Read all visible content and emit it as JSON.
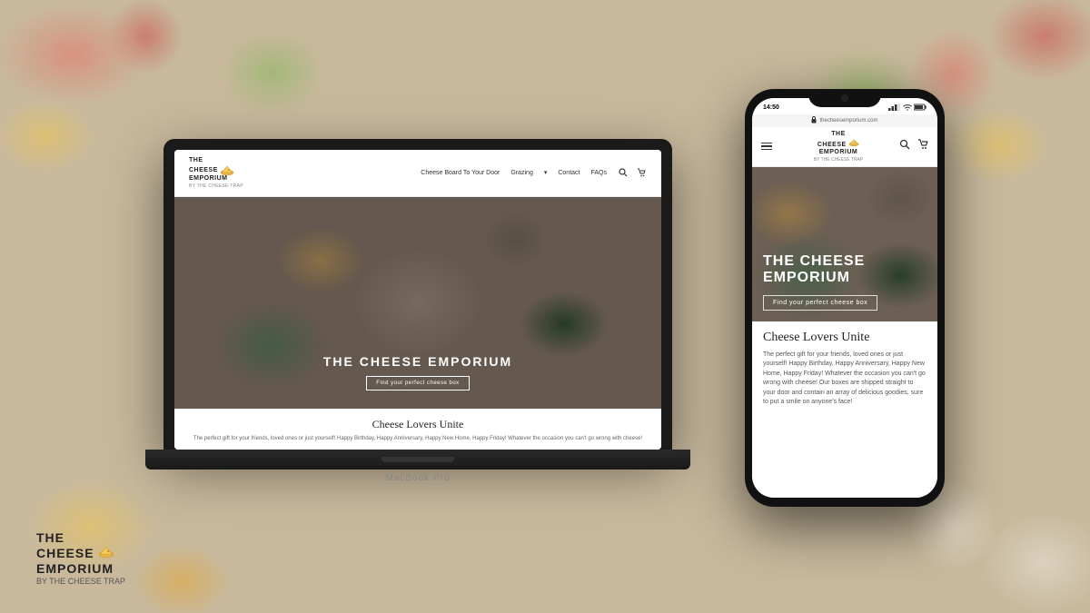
{
  "background": {
    "color": "#c8b89a"
  },
  "laptop": {
    "label": "MacBook Pro",
    "screen": {
      "nav": {
        "logo_line1": "THE",
        "logo_line2": "CHEESE",
        "logo_line3": "EMPORIUM",
        "logo_sub": "BY THE CHEESE TRAP",
        "links": [
          "Cheese Board To Your Door",
          "Grazing",
          "Contact",
          "FAQs"
        ]
      },
      "hero": {
        "title": "THE CHEESE EMPORIUM",
        "button": "Find your perfect cheese box"
      },
      "section": {
        "title": "Cheese Lovers Unite",
        "text": "The perfect gift for your friends, loved ones or just yourself! Happy Birthday, Happy Anniversary, Happy New Home, Happy Friday! Whatever the occasion you can't go wrong with cheese!"
      }
    }
  },
  "phone": {
    "status_bar": {
      "time": "14:50",
      "url": "thecheesemporium.com"
    },
    "screen": {
      "nav": {
        "logo_line1": "THE",
        "logo_line2": "CHEESE",
        "logo_line3": "EMPORIUM",
        "logo_sub": "BY THE CHEESE TRAP"
      },
      "hero": {
        "title_line1": "THE CHEESE",
        "title_line2": "EMPORIUM",
        "button": "Find your perfect cheese box"
      },
      "section": {
        "title": "Cheese Lovers Unite",
        "text": "The perfect gift for your friends, loved ones or just yourself! Happy Birthday, Happy Anniversary, Happy New Home, Happy Friday! Whatever the occasion you can't go wrong with cheese! Our boxes are shipped straight to your door and contain an array of delicious goodies, sure to put a smile on anyone's face!"
      }
    }
  },
  "bottom_logo": {
    "line1": "THE",
    "line2": "CHEESE",
    "line3": "EMPORIUM",
    "sub": "BY THE CHEESE TRAP"
  },
  "icons": {
    "search": "🔍",
    "cart": "🛒",
    "signal": "▲▲▲",
    "wifi": "wifi",
    "battery": "▮▮▮",
    "lock": "🔒",
    "chevron_down": "▾"
  }
}
